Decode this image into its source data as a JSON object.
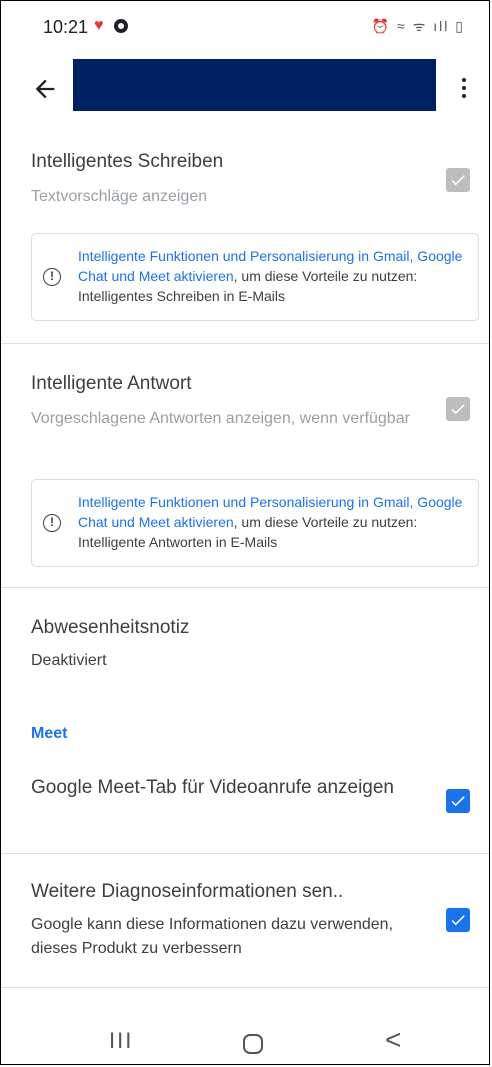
{
  "status_bar": {
    "time": "10:21",
    "heart_icon": "heart-icon",
    "right_icons": "⏰ ≈ ᯤ ıll ▯"
  },
  "app_bar": {
    "back_icon": "arrow-back-icon",
    "more_icon": "more-vert-icon"
  },
  "smart_compose": {
    "title": "Intelligentes Schreiben",
    "subtitle": "Textvorschläge anzeigen",
    "checked": true,
    "enabled": false,
    "info": {
      "link": "Intelligente Funktionen und Personalisierung in Gmail, Google Chat und Meet aktivieren",
      "text": ", um diese Vorteile zu nutzen: Intelligentes Schreiben in E-Mails"
    }
  },
  "smart_reply": {
    "title": "Intelligente Antwort",
    "subtitle": "Vorgeschlagene Antworten anzeigen, wenn verfügbar",
    "checked": true,
    "enabled": false,
    "info": {
      "link": "Intelligente Funktionen und Personalisierung in Gmail, Google Chat und Meet aktivieren",
      "text": ", um diese Vorteile zu nutzen: Intelligente Antworten in E-Mails"
    }
  },
  "vacation": {
    "title": "Abwesenheitsnotiz",
    "subtitle": "Deaktiviert"
  },
  "meet_section": {
    "label": "Meet",
    "meet_tab": {
      "title": "Google Meet-Tab für Videoanrufe anzeigen",
      "checked": true
    }
  },
  "diagnostics": {
    "title": "Weitere Diagnoseinformationen sen..",
    "subtitle": "Google kann diese Informationen dazu verwenden, dieses Produkt zu verbessern",
    "checked": true
  },
  "nav_bar": {
    "recent_label": "III",
    "back_label": "<"
  },
  "colors": {
    "accent": "#1a73e8",
    "redaction": "#002060",
    "disabled_checkbox": "#bdbdbd"
  }
}
